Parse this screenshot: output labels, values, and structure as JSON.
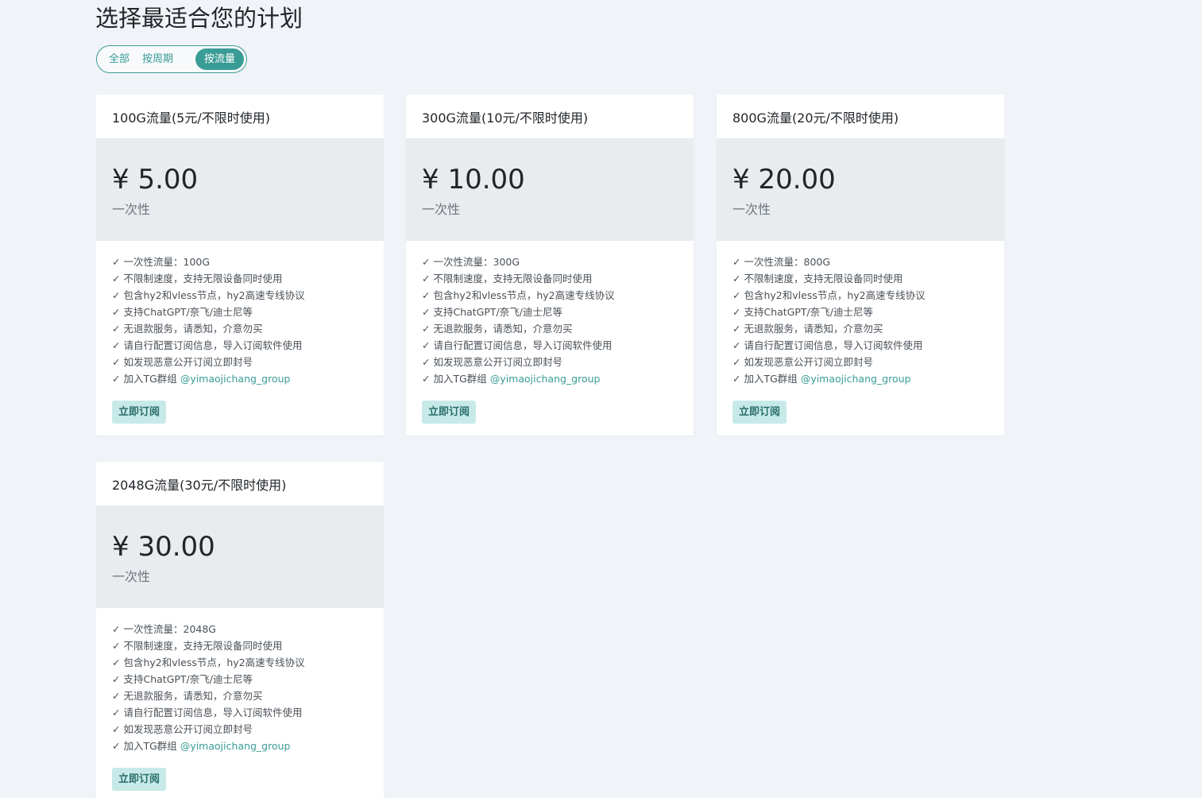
{
  "page": {
    "title": "选择最适合您的计划"
  },
  "filters": {
    "all": "全部",
    "by_period": "按周期",
    "by_traffic": "按流量",
    "active": "按流量"
  },
  "colors": {
    "accent": "#3a9c96",
    "button_bg": "#c7eae8",
    "price_bg": "#e9ecef",
    "page_bg": "#f0f3f7"
  },
  "plans": [
    {
      "name": "100G流量(5元/不限时使用)",
      "price": "¥ 5.00",
      "period": "一次性",
      "features": [
        "一次性流量：100G",
        "不限制速度，支持无限设备同时使用",
        "包含hy2和vless节点，hy2高速专线协议",
        "支持ChatGPT/奈飞/迪士尼等",
        "无退款服务，请悉知，介意勿买",
        "请自行配置订阅信息，导入订阅软件使用",
        "如发现恶意公开订阅立即封号",
        "加入TG群组"
      ],
      "tg_link": "@yimaojichang_group",
      "button": "立即订阅"
    },
    {
      "name": "300G流量(10元/不限时使用)",
      "price": "¥ 10.00",
      "period": "一次性",
      "features": [
        "一次性流量：300G",
        "不限制速度，支持无限设备同时使用",
        "包含hy2和vless节点，hy2高速专线协议",
        "支持ChatGPT/奈飞/迪士尼等",
        "无退款服务，请悉知，介意勿买",
        "请自行配置订阅信息，导入订阅软件使用",
        "如发现恶意公开订阅立即封号",
        "加入TG群组"
      ],
      "tg_link": "@yimaojichang_group",
      "button": "立即订阅"
    },
    {
      "name": "800G流量(20元/不限时使用)",
      "price": "¥ 20.00",
      "period": "一次性",
      "features": [
        "一次性流量：800G",
        "不限制速度，支持无限设备同时使用",
        "包含hy2和vless节点，hy2高速专线协议",
        "支持ChatGPT/奈飞/迪士尼等",
        "无退款服务，请悉知，介意勿买",
        "请自行配置订阅信息，导入订阅软件使用",
        "如发现恶意公开订阅立即封号",
        "加入TG群组"
      ],
      "tg_link": "@yimaojichang_group",
      "button": "立即订阅"
    },
    {
      "name": "2048G流量(30元/不限时使用)",
      "price": "¥ 30.00",
      "period": "一次性",
      "features": [
        "一次性流量：2048G",
        "不限制速度，支持无限设备同时使用",
        "包含hy2和vless节点，hy2高速专线协议",
        "支持ChatGPT/奈飞/迪士尼等",
        "无退款服务，请悉知，介意勿买",
        "请自行配置订阅信息，导入订阅软件使用",
        "如发现恶意公开订阅立即封号",
        "加入TG群组"
      ],
      "tg_link": "@yimaojichang_group",
      "button": "立即订阅"
    }
  ]
}
